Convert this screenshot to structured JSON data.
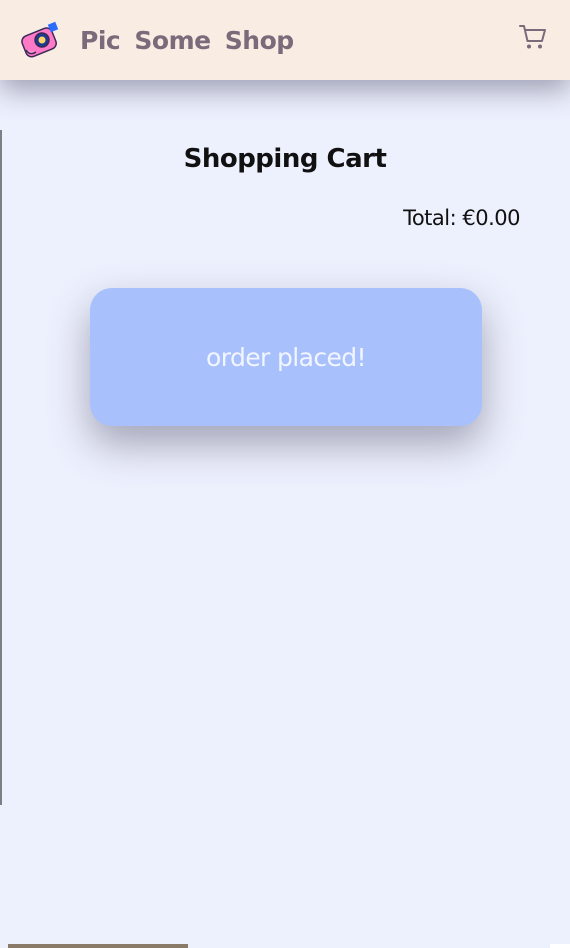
{
  "header": {
    "brand": "Pic Some Shop",
    "logo_icon": "camera-logo-icon",
    "cart_icon": "shopping-cart-icon"
  },
  "cart": {
    "title": "Shopping Cart",
    "total_label": "Total: €0.00",
    "order_button_label": "order placed!"
  },
  "colors": {
    "header_bg": "#f8ece3",
    "page_bg": "#edf0fd",
    "button_bg": "#a8c1fc",
    "brand_text": "#7a6a7a"
  }
}
